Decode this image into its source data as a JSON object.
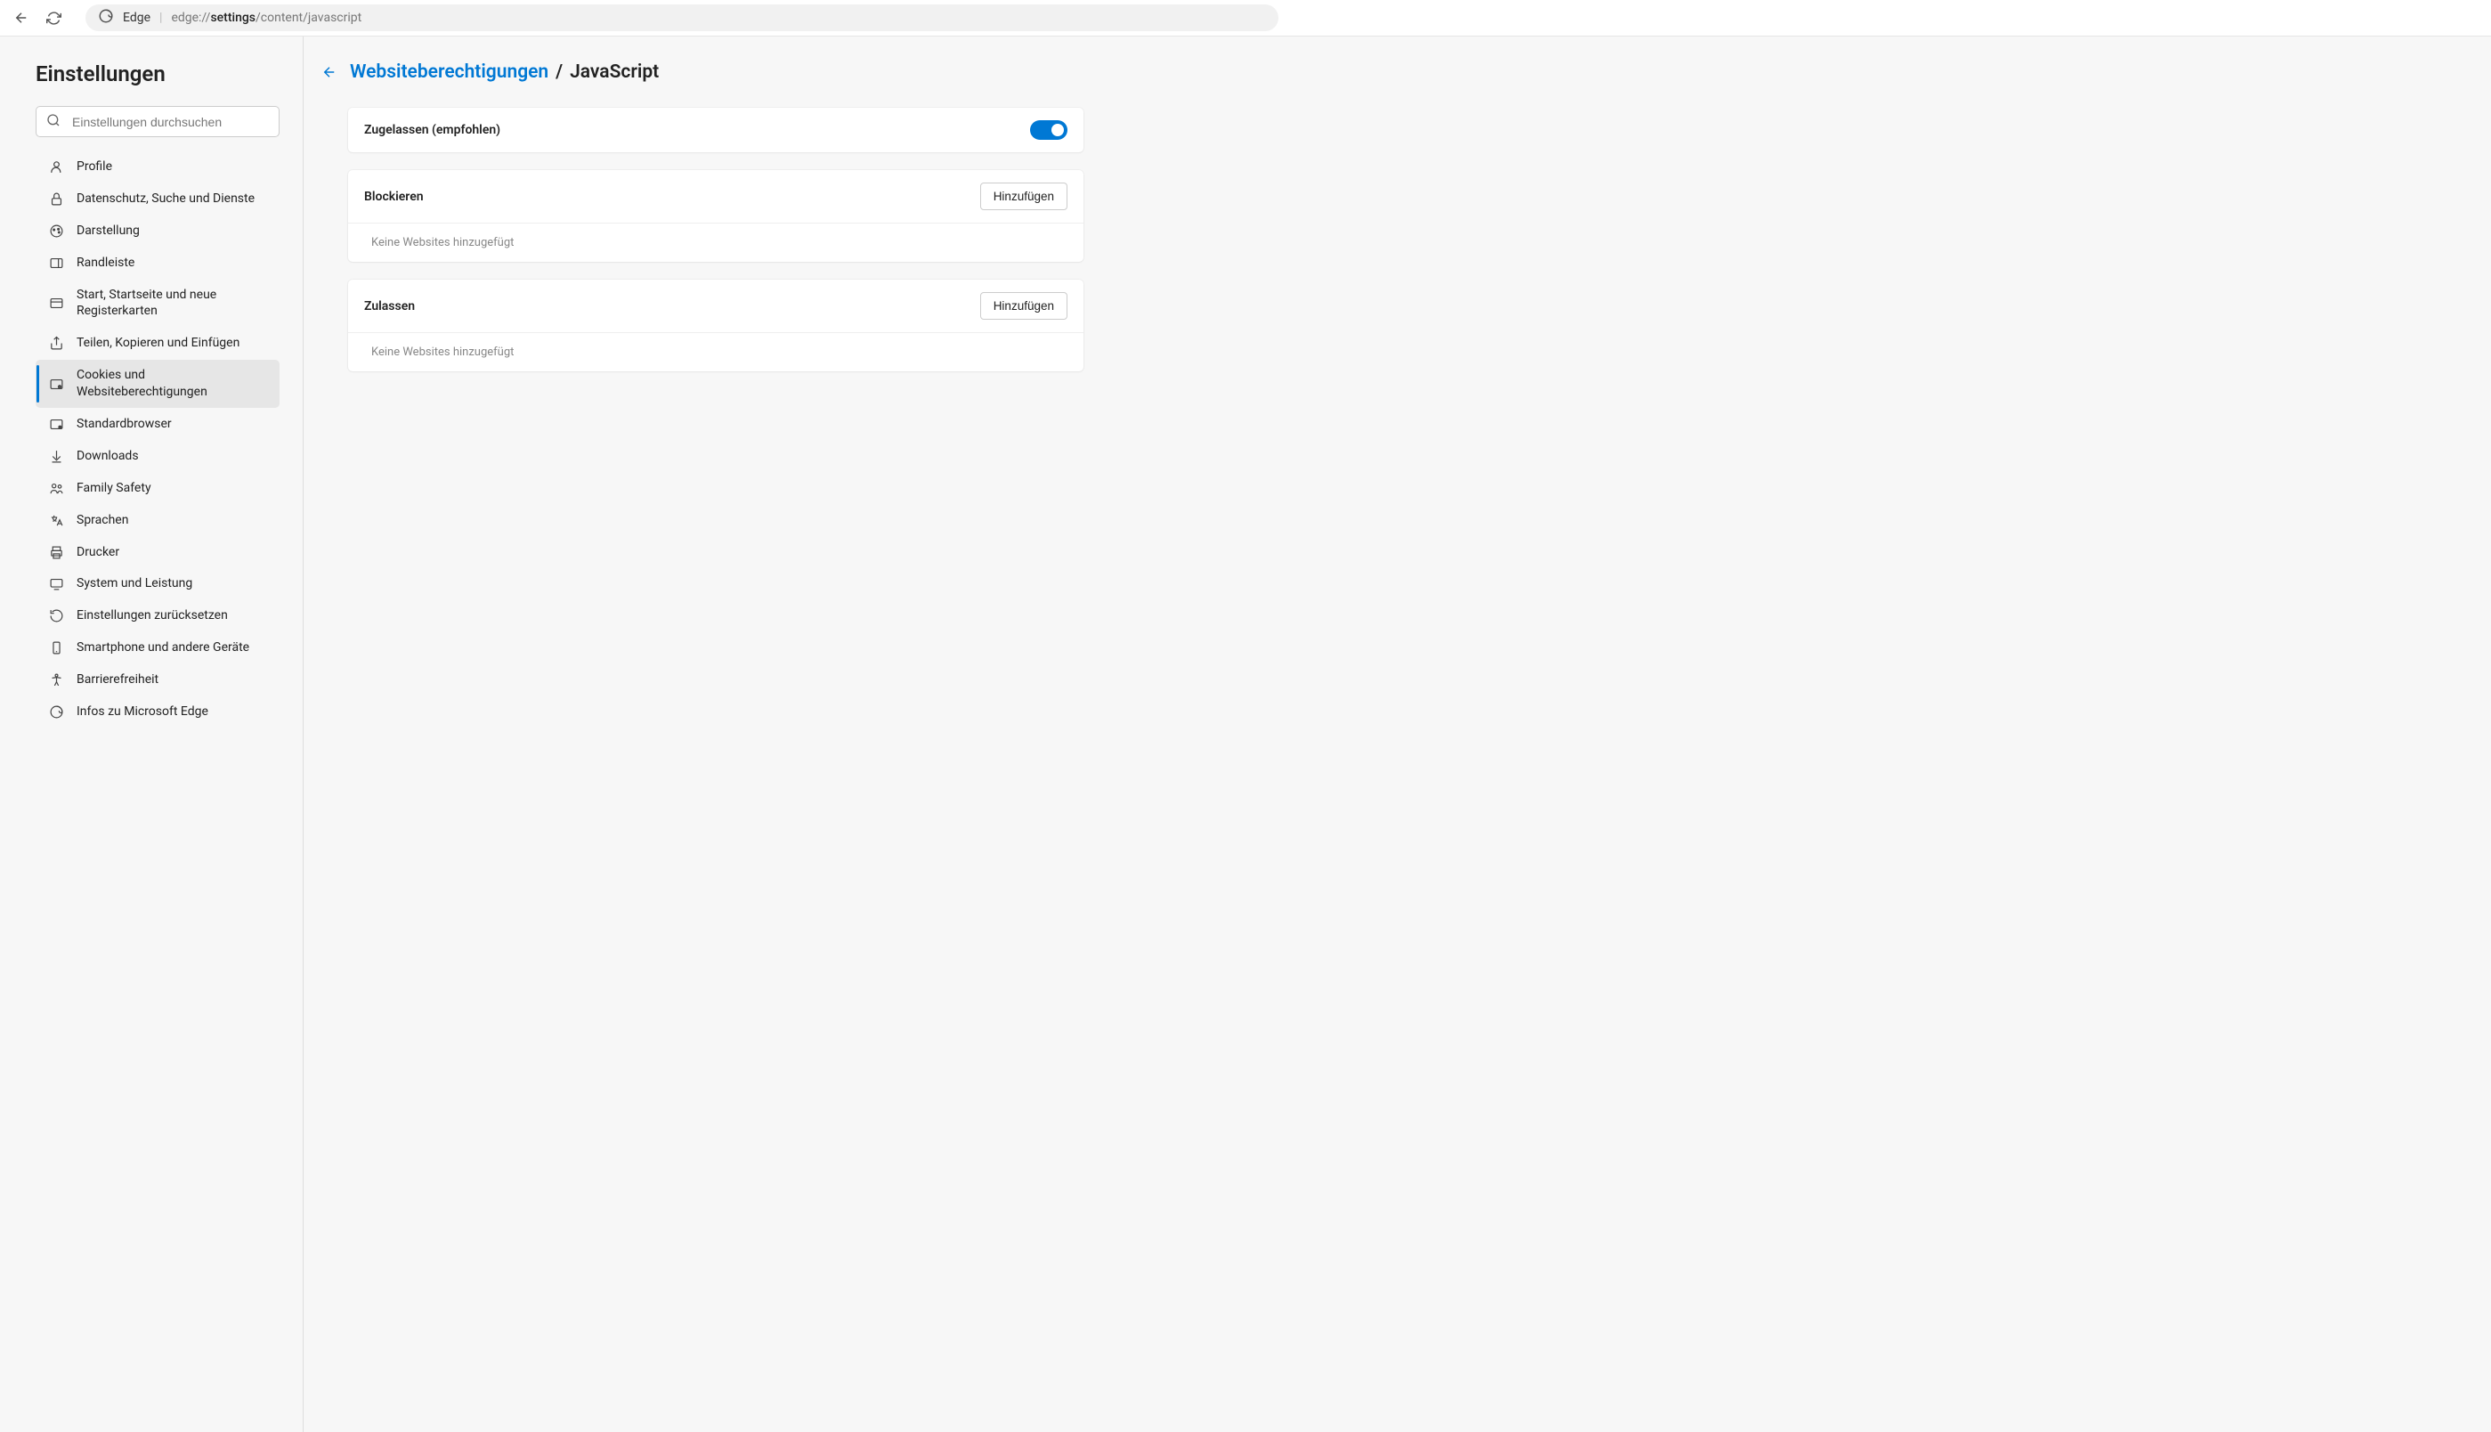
{
  "chrome": {
    "app_label": "Edge",
    "url_prefix": "edge://",
    "url_bold": "settings",
    "url_suffix": "/content/javascript"
  },
  "sidebar": {
    "title": "Einstellungen",
    "search_placeholder": "Einstellungen durchsuchen",
    "items": [
      {
        "label": "Profile",
        "icon": "user-icon",
        "active": false
      },
      {
        "label": "Datenschutz, Suche und Dienste",
        "icon": "lock-icon",
        "active": false
      },
      {
        "label": "Darstellung",
        "icon": "paint-icon",
        "active": false
      },
      {
        "label": "Randleiste",
        "icon": "sidebar-icon",
        "active": false
      },
      {
        "label": "Start, Startseite und neue Registerkarten",
        "icon": "home-tab-icon",
        "active": false
      },
      {
        "label": "Teilen, Kopieren und Einfügen",
        "icon": "share-icon",
        "active": false
      },
      {
        "label": "Cookies und Websiteberechtigungen",
        "icon": "cookies-icon",
        "active": true
      },
      {
        "label": "Standardbrowser",
        "icon": "default-browser-icon",
        "active": false
      },
      {
        "label": "Downloads",
        "icon": "download-icon",
        "active": false
      },
      {
        "label": "Family Safety",
        "icon": "family-icon",
        "active": false
      },
      {
        "label": "Sprachen",
        "icon": "language-icon",
        "active": false
      },
      {
        "label": "Drucker",
        "icon": "printer-icon",
        "active": false
      },
      {
        "label": "System und Leistung",
        "icon": "system-icon",
        "active": false
      },
      {
        "label": "Einstellungen zurücksetzen",
        "icon": "reset-icon",
        "active": false
      },
      {
        "label": "Smartphone und andere Geräte",
        "icon": "phone-icon",
        "active": false
      },
      {
        "label": "Barrierefreiheit",
        "icon": "accessibility-icon",
        "active": false
      },
      {
        "label": "Infos zu Microsoft Edge",
        "icon": "edge-icon",
        "active": false
      }
    ]
  },
  "main": {
    "breadcrumb_link": "Websiteberechtigungen",
    "breadcrumb_sep": "/",
    "breadcrumb_current": "JavaScript",
    "allowed_row": {
      "title": "Zugelassen (empfohlen)",
      "toggle_on": true
    },
    "block_section": {
      "title": "Blockieren",
      "add_button": "Hinzufügen",
      "empty": "Keine Websites hinzugefügt"
    },
    "allow_section": {
      "title": "Zulassen",
      "add_button": "Hinzufügen",
      "empty": "Keine Websites hinzugefügt"
    }
  }
}
